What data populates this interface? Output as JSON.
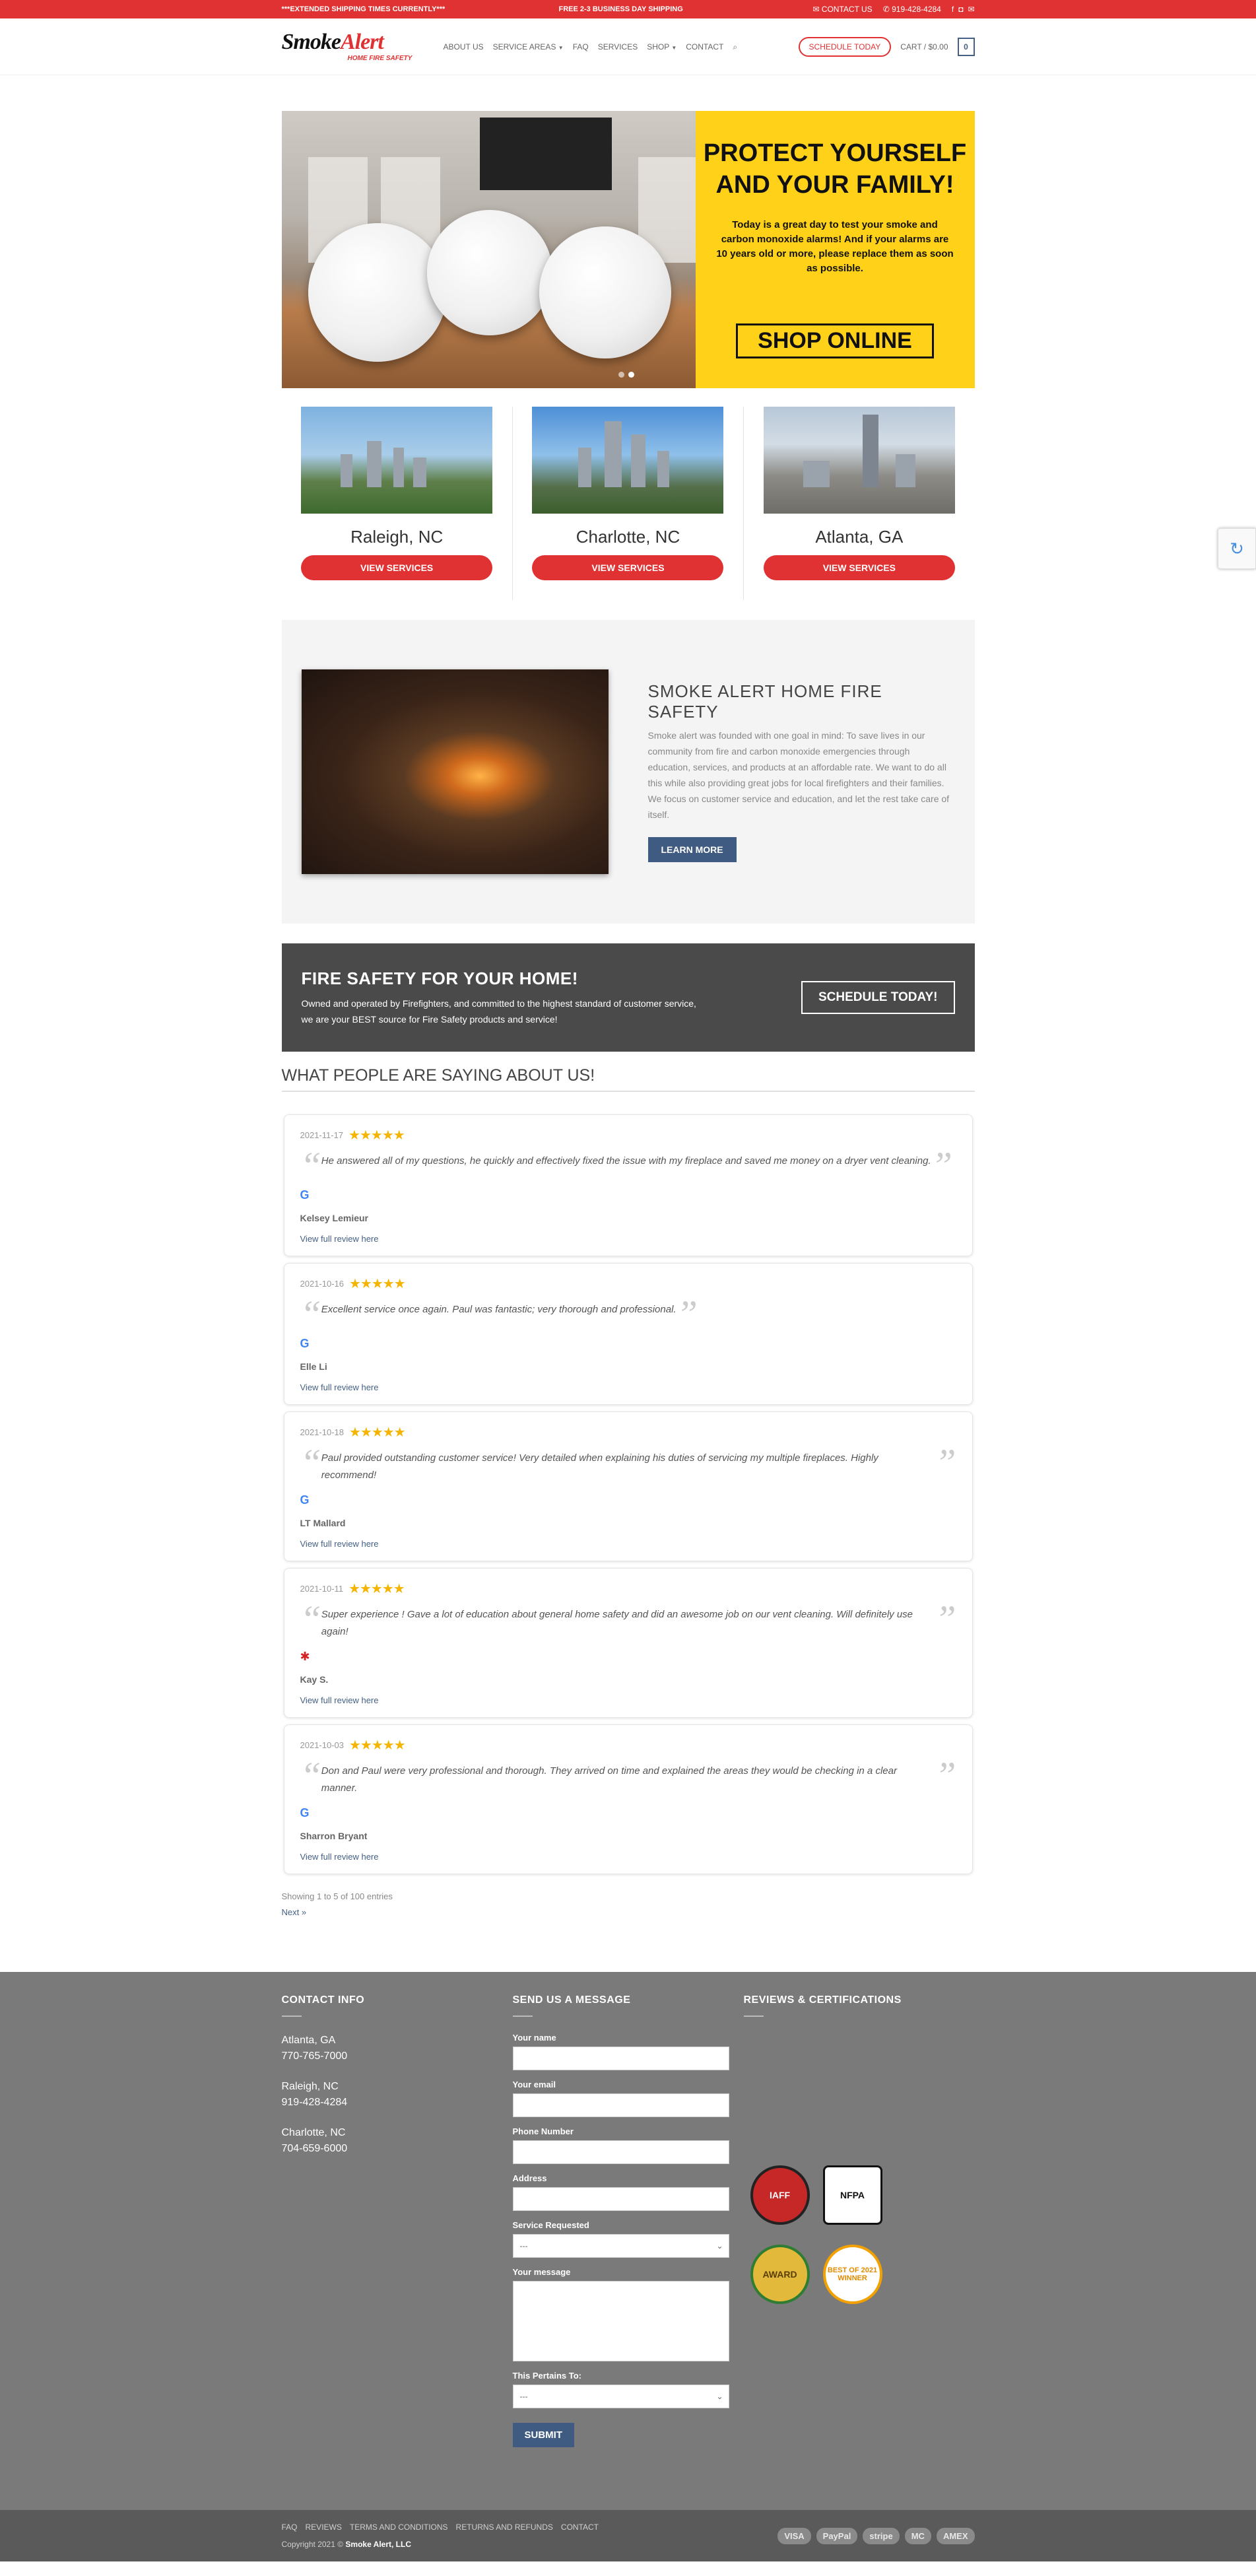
{
  "topbar": {
    "left_text": "***EXTENDED SHIPPING TIMES CURRENTLY***",
    "center_text": "FREE 2-3 BUSINESS DAY SHIPPING",
    "contact_label": "CONTACT US",
    "phone": "919-428-4284"
  },
  "header": {
    "logo_main": "SmokeAlert",
    "logo_sub": "HOME FIRE SAFETY",
    "nav": [
      "ABOUT US",
      "SERVICE AREAS",
      "FAQ",
      "SERVICES",
      "SHOP",
      "CONTACT"
    ],
    "schedule_label": "SCHEDULE TODAY",
    "cart_label": "CART / $0.00",
    "cart_count": "0"
  },
  "hero": {
    "title_line1": "PROTECT YOURSELF",
    "title_line2": "AND YOUR FAMILY!",
    "body": "Today is a great day to test your smoke and carbon monoxide alarms!  And if your alarms are 10 years old or more, please replace them as soon as possible.",
    "cta": "SHOP ONLINE"
  },
  "cities": [
    {
      "name": "Raleigh, NC",
      "button": "VIEW SERVICES"
    },
    {
      "name": "Charlotte, NC",
      "button": "VIEW SERVICES"
    },
    {
      "name": "Atlanta, GA",
      "button": "VIEW SERVICES"
    }
  ],
  "about": {
    "title": "SMOKE ALERT HOME FIRE SAFETY",
    "body": "Smoke alert was founded with one goal in mind: To save lives in our community from fire and carbon monoxide emergencies through education, services, and products at an affordable rate. We want to do all this while also providing great jobs for local firefighters and their families. We focus on customer service and education, and let the rest take care of itself.",
    "button": "LEARN MORE"
  },
  "cta": {
    "title": "FIRE SAFETY FOR YOUR HOME!",
    "body": "Owned and operated by Firefighters, and committed to the highest standard of customer service, we are your BEST source for Fire Safety products and service!",
    "button": "SCHEDULE TODAY!"
  },
  "reviews": {
    "title": "WHAT PEOPLE ARE SAYING ABOUT US!",
    "items": [
      {
        "date": "2021-11-17",
        "stars": "★★★★★",
        "text": "He answered all of my questions, he quickly and effectively fixed the issue with my fireplace and saved me money on a dryer vent cleaning.",
        "source": "G",
        "name": "Kelsey Lemieur",
        "link": "View full review here"
      },
      {
        "date": "2021-10-16",
        "stars": "★★★★★",
        "text": "Excellent service once again. Paul was fantastic; very thorough and professional.",
        "source": "G",
        "name": "Elle Li",
        "link": "View full review here"
      },
      {
        "date": "2021-10-18",
        "stars": "★★★★★",
        "text": "Paul provided outstanding customer service! Very detailed when explaining his duties of servicing my multiple fireplaces. Highly recommend!",
        "source": "G",
        "name": "LT Mallard",
        "link": "View full review here"
      },
      {
        "date": "2021-10-11",
        "stars": "★★★★★",
        "text": "Super experience ! Gave a lot of education about general home safety and did an awesome job on our vent cleaning. Will definitely use again!",
        "source": "✱",
        "name": "Kay S.",
        "link": "View full review here"
      },
      {
        "date": "2021-10-03",
        "stars": "★★★★★",
        "text": "Don and Paul were very professional and thorough. They arrived on time and explained the areas they would be checking in a clear manner.",
        "source": "G",
        "name": "Sharron Bryant",
        "link": "View full review here"
      }
    ],
    "showing": "Showing 1 to 5 of 100 entries",
    "next": "Next »"
  },
  "footer": {
    "contact_title": "CONTACT INFO",
    "locations": [
      {
        "city": "Atlanta, GA",
        "phone": "770-765-7000"
      },
      {
        "city": "Raleigh, NC",
        "phone": "919-428-4284"
      },
      {
        "city": "Charlotte, NC",
        "phone": "704-659-6000"
      }
    ],
    "message_title": "SEND US A MESSAGE",
    "fields": {
      "name": "Your name",
      "email": "Your email",
      "phone": "Phone Number",
      "address": "Address",
      "service": "Service Requested",
      "service_value": "---",
      "message": "Your message",
      "pertains": "This Pertains To:",
      "pertains_value": "---",
      "submit": "SUBMIT"
    },
    "reviews_title": "REVIEWS & CERTIFICATIONS",
    "badges": [
      "IAFF",
      "NFPA",
      "AWARD",
      "BEST OF 2021 WINNER"
    ],
    "legal_links": [
      "FAQ",
      "REVIEWS",
      "TERMS AND CONDITIONS",
      "RETURNS AND REFUNDS",
      "CONTACT"
    ],
    "copyright_prefix": "Copyright 2021 ©",
    "copyright_company": "Smoke Alert, LLC",
    "payments": [
      "VISA",
      "PayPal",
      "stripe",
      "MC",
      "AMEX"
    ]
  },
  "colors": {
    "brand_red": "#e03232",
    "promo_yellow": "#ffd119",
    "accent_blue": "#3f5b82",
    "footer_gray": "#7a7a7a",
    "star_gold": "#f4b400"
  }
}
